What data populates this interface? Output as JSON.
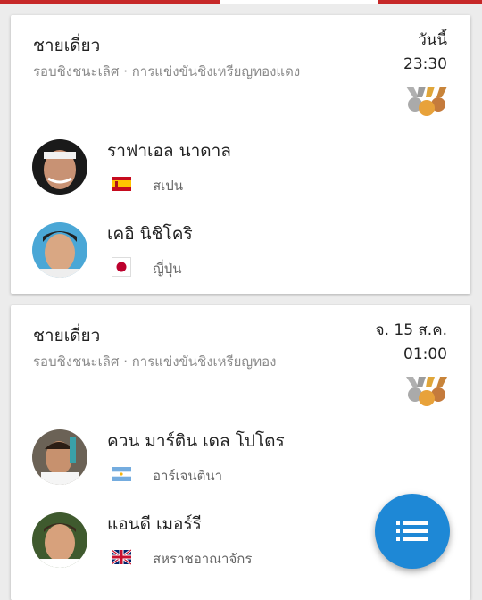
{
  "colors": {
    "app_bar": "#c62828",
    "fab": "#1e88d6",
    "background": "#ececec"
  },
  "matches": [
    {
      "event": "ชายเดี่ยว",
      "round": "รอบชิงชนะเลิศ · การแข่งขันชิงเหรียญทองแดง",
      "day": "วันนี้",
      "time": "23:30",
      "medal_icon": "medals-icon",
      "athletes": [
        {
          "name": "ราฟาเอล นาดาล",
          "country": "สเปน",
          "flag": "spain-flag-icon"
        },
        {
          "name": "เคอิ นิชิโคริ",
          "country": "ญี่ปุ่น",
          "flag": "japan-flag-icon"
        }
      ]
    },
    {
      "event": "ชายเดี่ยว",
      "round": "รอบชิงชนะเลิศ · การแข่งขันชิงเหรียญทอง",
      "day": "จ. 15 ส.ค.",
      "time": "01:00",
      "medal_icon": "medals-icon",
      "athletes": [
        {
          "name": "ควน มาร์ติน เดล โปโตร",
          "country": "อาร์เจนตินา",
          "flag": "argentina-flag-icon"
        },
        {
          "name": "แอนดี เมอร์รี",
          "country": "สหราชอาณาจักร",
          "flag": "uk-flag-icon"
        }
      ]
    }
  ],
  "fab": {
    "icon": "list-icon"
  }
}
